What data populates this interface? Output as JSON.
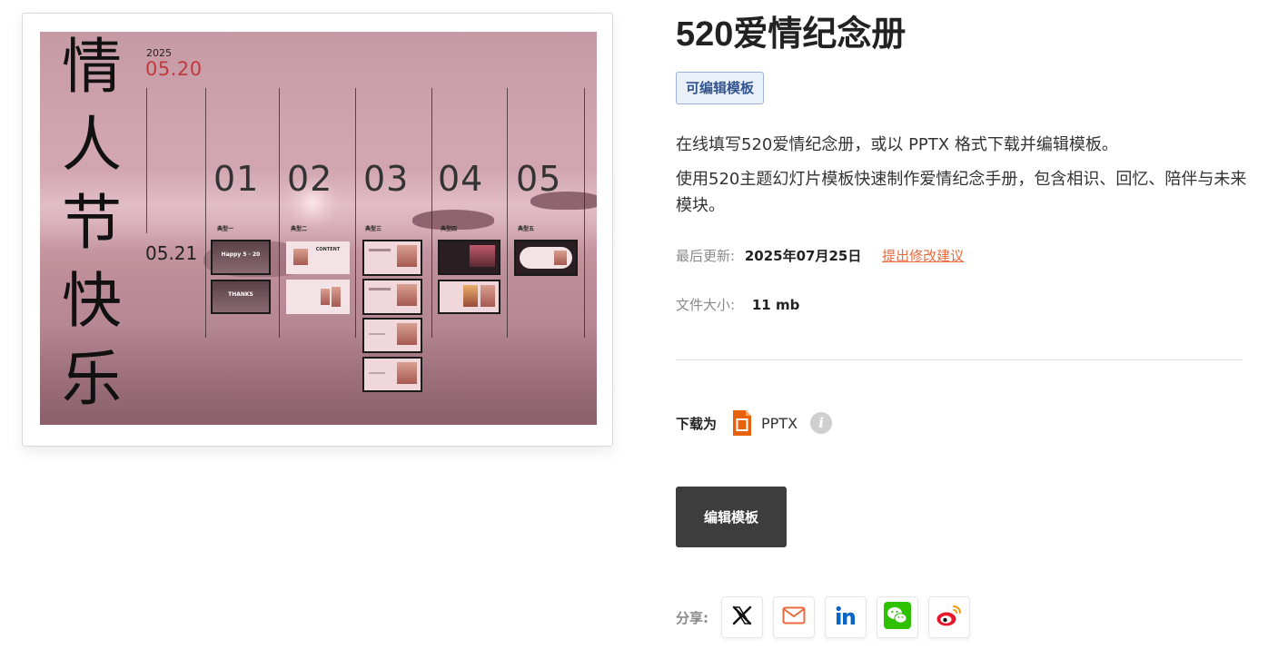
{
  "preview": {
    "title_vertical": [
      "情",
      "人",
      "节",
      "快",
      "乐"
    ],
    "year": "2025",
    "date_main": "05.20",
    "date_secondary": "05.21",
    "columns": [
      {
        "num": "01",
        "type": "典型一"
      },
      {
        "num": "02",
        "type": "典型二"
      },
      {
        "num": "03",
        "type": "典型三"
      },
      {
        "num": "04",
        "type": "典型四"
      },
      {
        "num": "05",
        "type": "典型五"
      }
    ],
    "thumb_labels": {
      "happy": "Happy 5 · 20",
      "thanks": "THANKS",
      "content": "CONTENT"
    }
  },
  "product": {
    "title": "520爱情纪念册",
    "badge": "可编辑模板",
    "description_1": "在线填写520爱情纪念册，或以 PPTX 格式下载并编辑模板。",
    "description_2": "使用520主题幻灯片模板快速制作爱情纪念手册，包含相识、回忆、陪伴与未来模块。",
    "updated_label": "最后更新:",
    "updated_value": "2025年07月25日",
    "suggest_link": "提出修改建议",
    "size_label": "文件大小:",
    "size_value": "11 mb"
  },
  "download": {
    "label": "下载为",
    "file_type": "PPTX",
    "info_glyph": "i"
  },
  "actions": {
    "edit_label": "编辑模板"
  },
  "share": {
    "label": "分享:",
    "buttons": [
      "x-icon",
      "email-icon",
      "linkedin-icon",
      "wechat-icon",
      "weibo-icon"
    ]
  },
  "colors": {
    "accent_orange": "#e86a3d",
    "badge_bg": "#eaf0fa",
    "badge_text": "#33568f",
    "button_dark": "#3d3d3d",
    "slide_pink": "#cfa3ae",
    "date_red": "#c0393d",
    "wechat_green": "#2dc100",
    "linkedin_blue": "#0a66c2",
    "weibo_red": "#e6162d"
  }
}
